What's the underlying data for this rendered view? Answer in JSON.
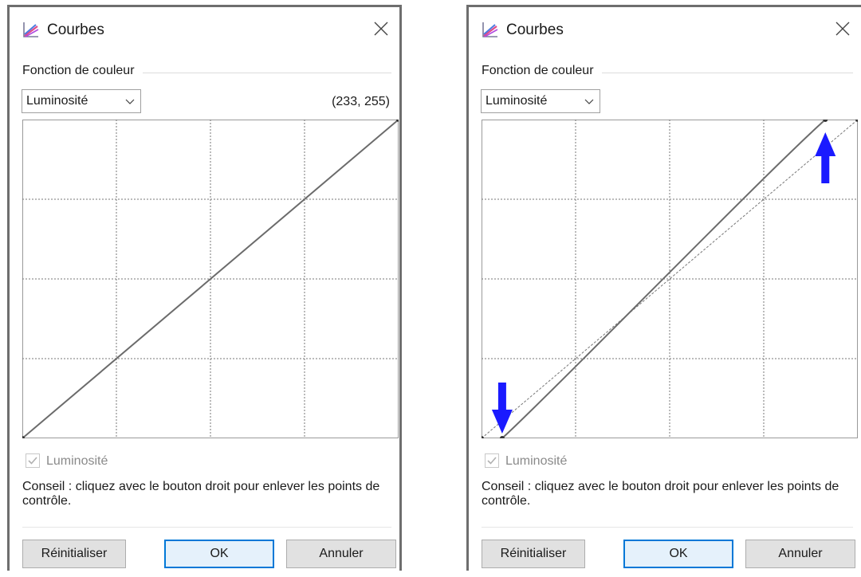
{
  "dialogs": [
    {
      "title": "Courbes",
      "section_label": "Fonction de couleur",
      "channel_select": "Luminosité",
      "coordinates": "(233, 255)",
      "checkbox": {
        "label": "Luminosité",
        "checked": true,
        "enabled": false
      },
      "hint": "Conseil : cliquez avec le bouton droit pour enlever les points de contrôle.",
      "buttons": {
        "reset": "Réinitialiser",
        "ok": "OK",
        "cancel": "Annuler"
      },
      "curve": {
        "input_range": [
          0,
          255
        ],
        "output_range": [
          0,
          255
        ],
        "control_points": [
          [
            0,
            0
          ],
          [
            255,
            255
          ]
        ],
        "reference_diagonal": false,
        "arrow_annotations": []
      }
    },
    {
      "title": "Courbes",
      "section_label": "Fonction de couleur",
      "channel_select": "Luminosité",
      "coordinates": "",
      "checkbox": {
        "label": "Luminosité",
        "checked": true,
        "enabled": false
      },
      "hint": "Conseil : cliquez avec le bouton droit pour enlever les points de contrôle.",
      "buttons": {
        "reset": "Réinitialiser",
        "ok": "OK",
        "cancel": "Annuler"
      },
      "curve": {
        "input_range": [
          0,
          255
        ],
        "output_range": [
          0,
          255
        ],
        "control_points": [
          [
            0,
            0
          ],
          [
            14,
            0
          ],
          [
            233,
            255
          ],
          [
            255,
            255
          ]
        ],
        "reference_diagonal": true,
        "arrow_annotations": [
          {
            "direction": "down",
            "color": "#1a1aff"
          },
          {
            "direction": "up",
            "color": "#1a1aff"
          }
        ]
      }
    }
  ],
  "colors": {
    "curve_stroke": "#6b6b6b",
    "grid_stroke": "#777777",
    "ok_border": "#0078d7",
    "annotation_arrow": "#1a1aff"
  }
}
